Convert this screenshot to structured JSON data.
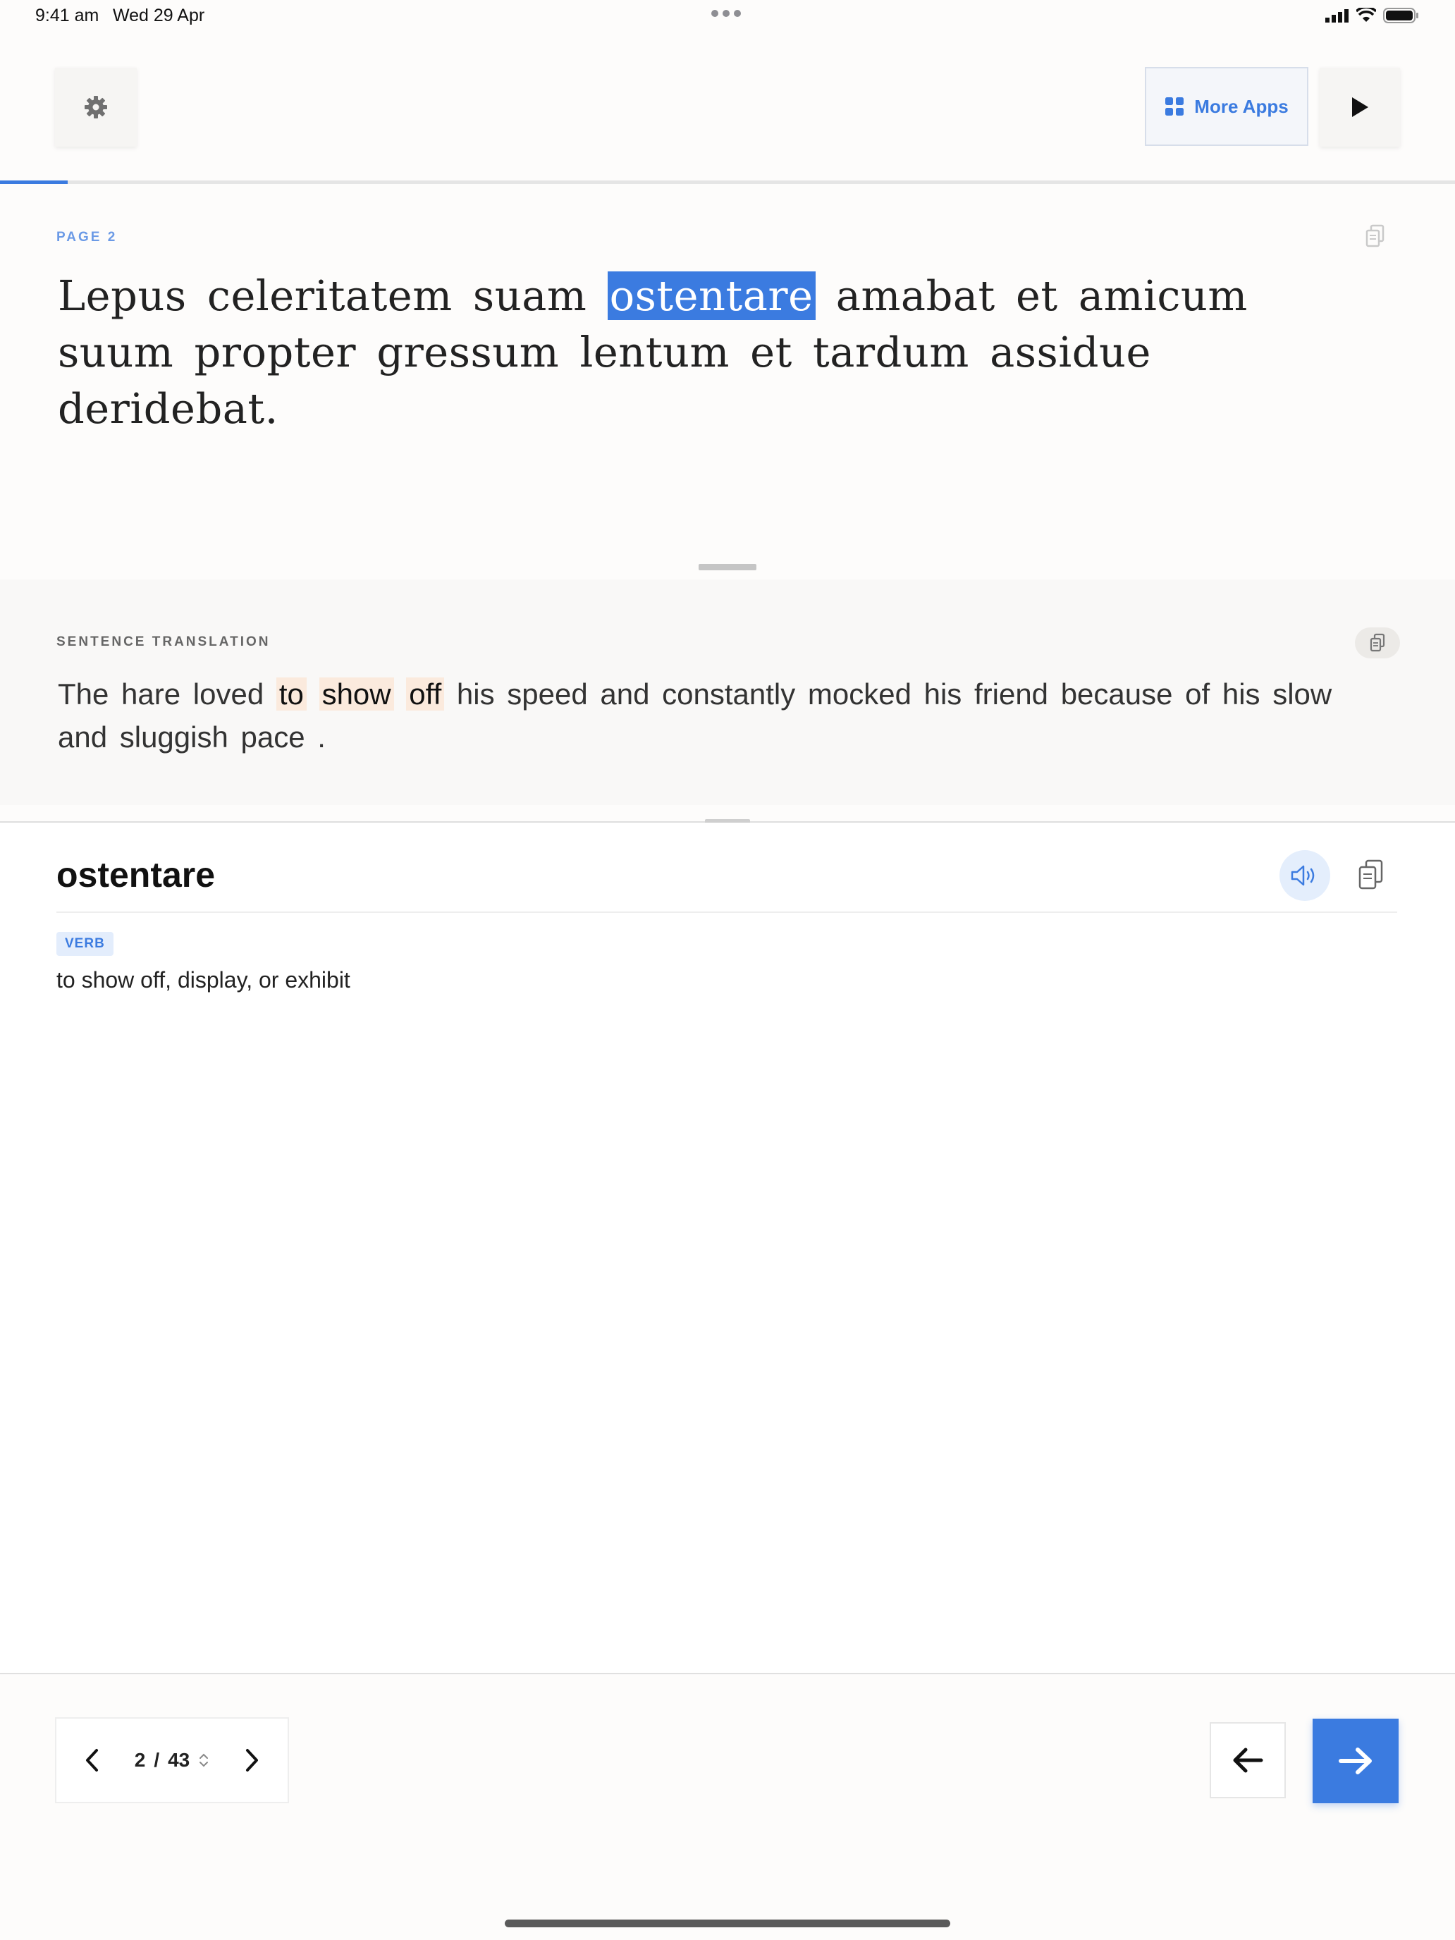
{
  "status_bar": {
    "time": "9:41 am",
    "date": "Wed 29 Apr"
  },
  "toolbar": {
    "more_apps_label": "More Apps"
  },
  "progress": {
    "fraction": 0.0465
  },
  "reader": {
    "page_label": "PAGE 2",
    "latin_before": "Lepus celeritatem suam ",
    "latin_highlight": "ostentare",
    "latin_after": " amabat et amicum suum propter gressum lentum et tardum assidue deridebat",
    "latin_period": "."
  },
  "translation": {
    "label": "SENTENCE TRANSLATION",
    "before": "The hare loved ",
    "hl1": "to",
    "hl2": "show",
    "hl3": "off",
    "after": " his speed and constantly mocked his friend because of his slow and sluggish pace",
    "period": "."
  },
  "definition": {
    "word": "ostentare",
    "part_of_speech": "VERB",
    "meaning": "to show off, display, or exhibit"
  },
  "pager": {
    "current": "2",
    "separator": "/",
    "total": "43"
  },
  "colors": {
    "accent": "#3b7be0",
    "highlight_soft": "#fbeadd"
  }
}
